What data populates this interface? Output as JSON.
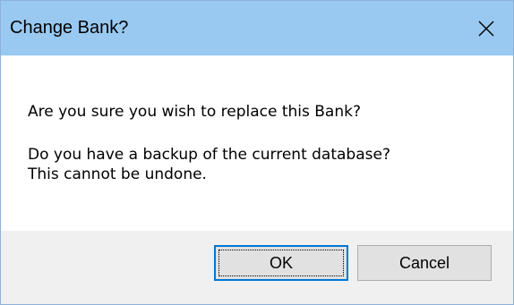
{
  "dialog": {
    "title": "Change Bank?",
    "close_icon": "close-icon",
    "message_line1": "Are you sure you wish to replace this Bank?",
    "message_line2": "Do you have a backup of the current database?",
    "message_line3": "This cannot be undone."
  },
  "buttons": {
    "ok_label": "OK",
    "cancel_label": "Cancel"
  },
  "colors": {
    "titlebar": "#99c9f1",
    "footer": "#f0f0f0",
    "focus_accent": "#0078d7"
  }
}
